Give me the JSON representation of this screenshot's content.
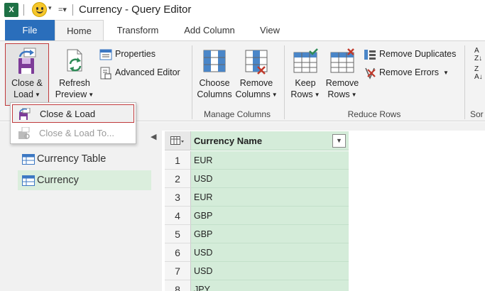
{
  "titlebar": {
    "app_icon_text": "X",
    "title": "Currency - Query Editor"
  },
  "tabs": [
    {
      "label": "File"
    },
    {
      "label": "Home"
    },
    {
      "label": "Transform"
    },
    {
      "label": "Add Column"
    },
    {
      "label": "View"
    }
  ],
  "ribbon": {
    "close_load": {
      "line1": "Close &",
      "line2": "Load"
    },
    "refresh_preview": {
      "line1": "Refresh",
      "line2": "Preview"
    },
    "properties": "Properties",
    "advanced_editor": "Advanced Editor",
    "choose_columns": {
      "line1": "Choose",
      "line2": "Columns"
    },
    "remove_columns": {
      "line1": "Remove",
      "line2": "Columns"
    },
    "manage_columns_label": "Manage Columns",
    "keep_rows": {
      "line1": "Keep",
      "line2": "Rows"
    },
    "remove_rows": {
      "line1": "Remove",
      "line2": "Rows"
    },
    "remove_duplicates": "Remove Duplicates",
    "remove_errors": "Remove Errors",
    "reduce_rows_label": "Reduce Rows",
    "sort_label": "Sor"
  },
  "dropdown": {
    "items": [
      {
        "label": "Close & Load"
      },
      {
        "label": "Close & Load To..."
      }
    ]
  },
  "queries": {
    "items": [
      {
        "label": "Currency Table"
      },
      {
        "label": "Currency"
      }
    ]
  },
  "grid": {
    "column_header": "Currency Name",
    "rows": [
      {
        "num": "1",
        "value": "EUR"
      },
      {
        "num": "2",
        "value": "USD"
      },
      {
        "num": "3",
        "value": "EUR"
      },
      {
        "num": "4",
        "value": "GBP"
      },
      {
        "num": "5",
        "value": "GBP"
      },
      {
        "num": "6",
        "value": "USD"
      },
      {
        "num": "7",
        "value": "USD"
      },
      {
        "num": "8",
        "value": "JPY"
      }
    ]
  },
  "colors": {
    "file_tab": "#2a6ebb",
    "selection_green": "#d4ecd9",
    "highlight_red": "#c0393b"
  }
}
